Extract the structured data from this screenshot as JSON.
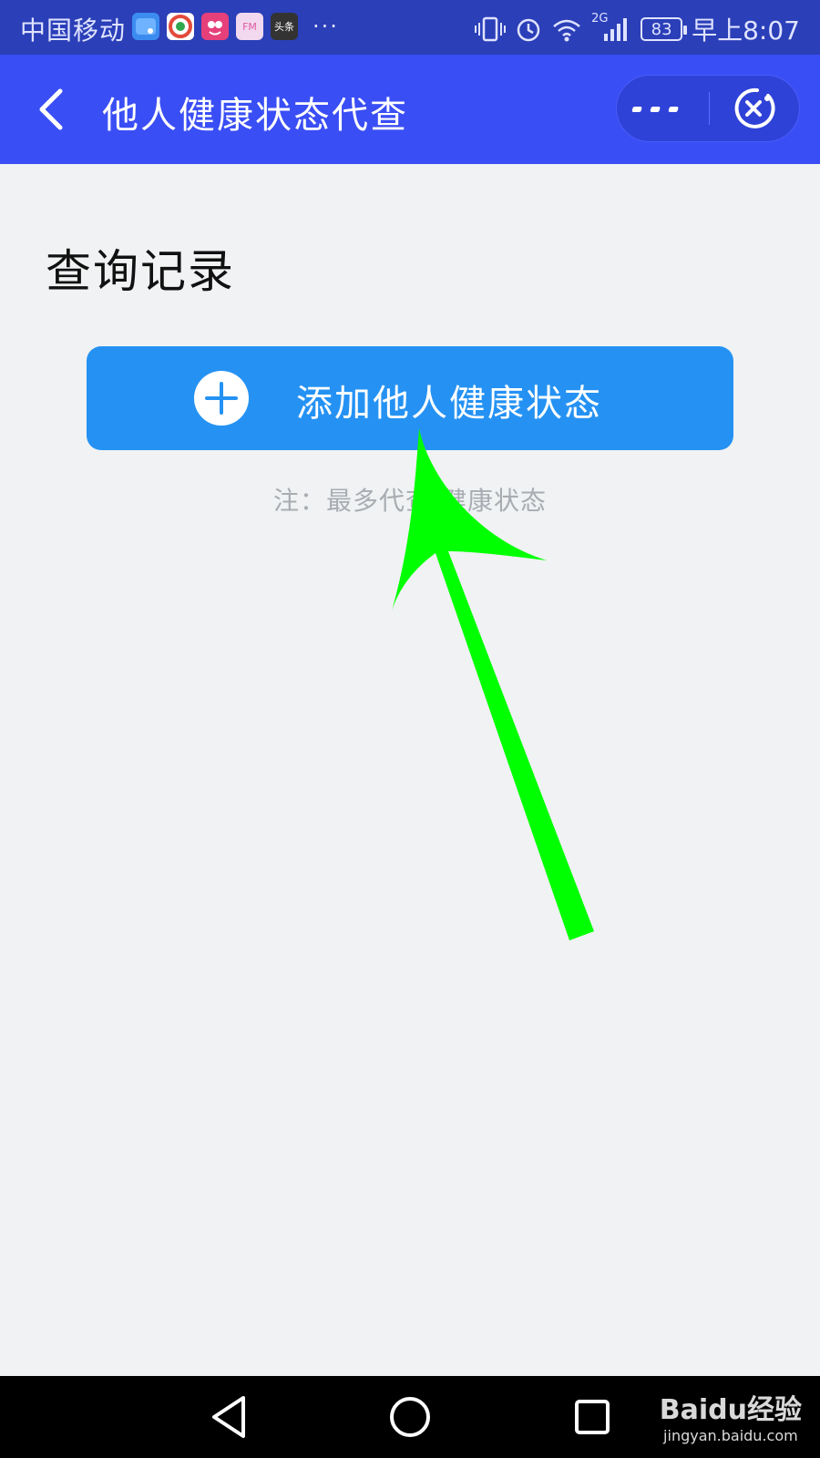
{
  "status_bar": {
    "carrier": "中国移动",
    "more": "···",
    "network": "2G",
    "battery": "83",
    "time": "早上8:07",
    "app_icons": [
      "weibo-blue-icon",
      "browser-icon",
      "cartoon-app-icon",
      "fm-radio-icon",
      "toutiao-icon"
    ],
    "fm_label": "FM",
    "toutiao_label": "头条"
  },
  "nav": {
    "title": "他人健康状态代查"
  },
  "content": {
    "section_title": "查询记录",
    "add_button_label": "添加他人健康状态",
    "note": "注：最多代查 健康状态"
  },
  "watermark": {
    "brand": "Baidu经验",
    "url": "jingyan.baidu.com"
  },
  "colors": {
    "status_bar": "#2b3fb8",
    "nav_bar": "#3a4ef5",
    "add_button": "#2592f3",
    "arrow": "#00ff00",
    "background": "#f0f2f3"
  }
}
